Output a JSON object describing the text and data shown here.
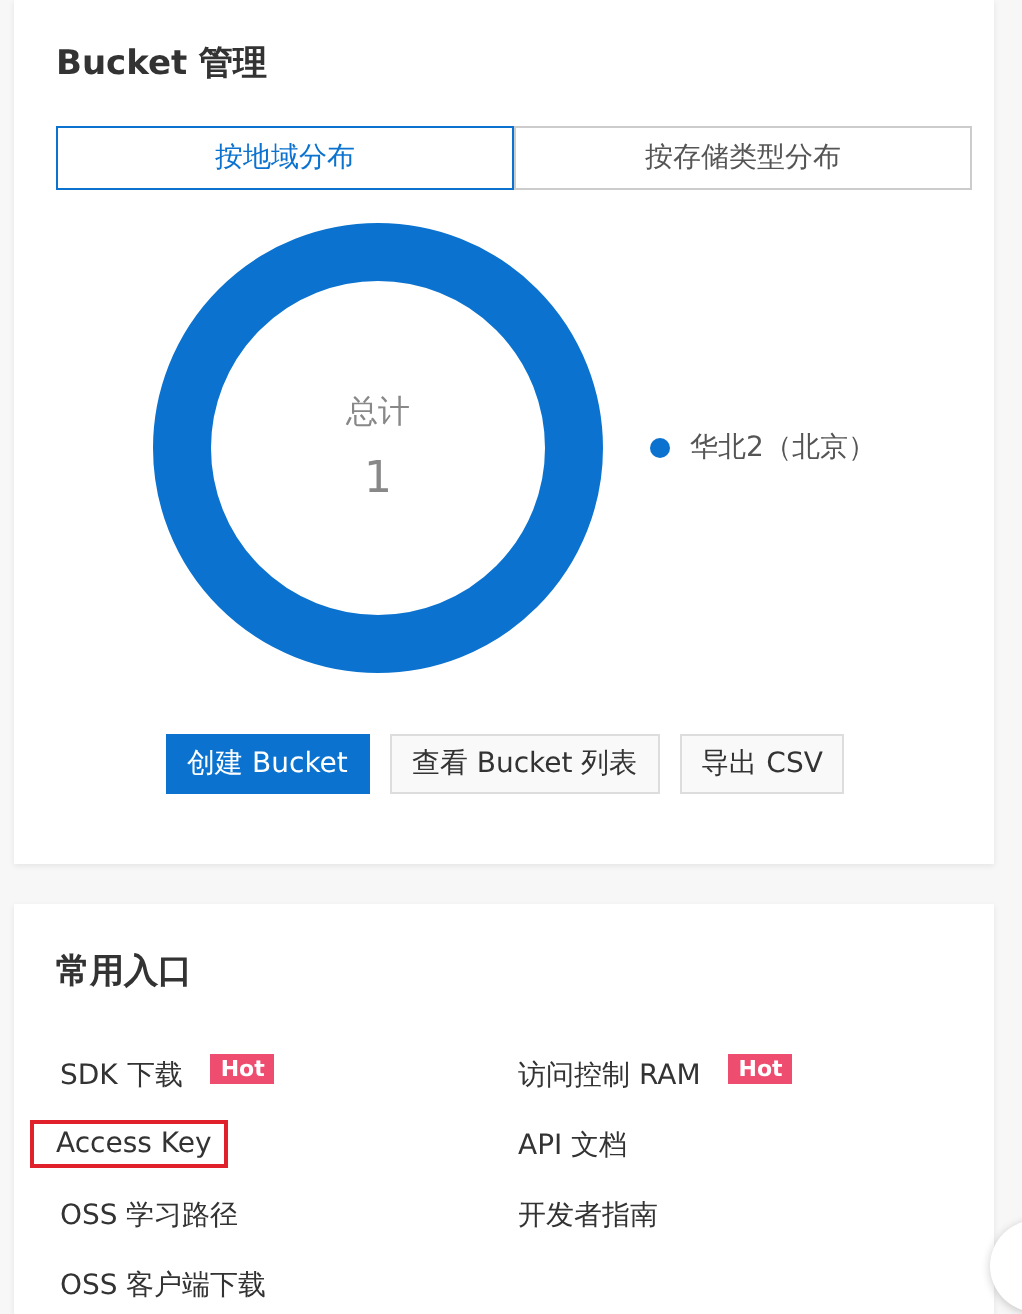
{
  "bucket_panel": {
    "title": "Bucket 管理",
    "tabs": [
      {
        "label": "按地域分布",
        "selected": true
      },
      {
        "label": "按存储类型分布",
        "selected": false
      }
    ],
    "total_label": "总计",
    "total_value": "1",
    "legend": [
      {
        "label": "华北2（北京）",
        "color": "#0b73cf"
      }
    ],
    "buttons": [
      {
        "label": "创建 Bucket",
        "kind": "primary"
      },
      {
        "label": "查看 Bucket 列表",
        "kind": "default"
      },
      {
        "label": "导出 CSV",
        "kind": "default"
      }
    ]
  },
  "shortcuts_panel": {
    "title": "常用入口",
    "links": [
      {
        "label": "SDK 下载",
        "badge": "Hot",
        "highlighted": false
      },
      {
        "label": "访问控制 RAM",
        "badge": "Hot",
        "highlighted": false
      },
      {
        "label": "Access Key",
        "highlighted": true
      },
      {
        "label": "API 文档",
        "highlighted": false
      },
      {
        "label": "OSS 学习路径",
        "highlighted": false
      },
      {
        "label": "开发者指南",
        "highlighted": false
      },
      {
        "label": "OSS 客户端下载",
        "highlighted": false
      }
    ]
  }
}
